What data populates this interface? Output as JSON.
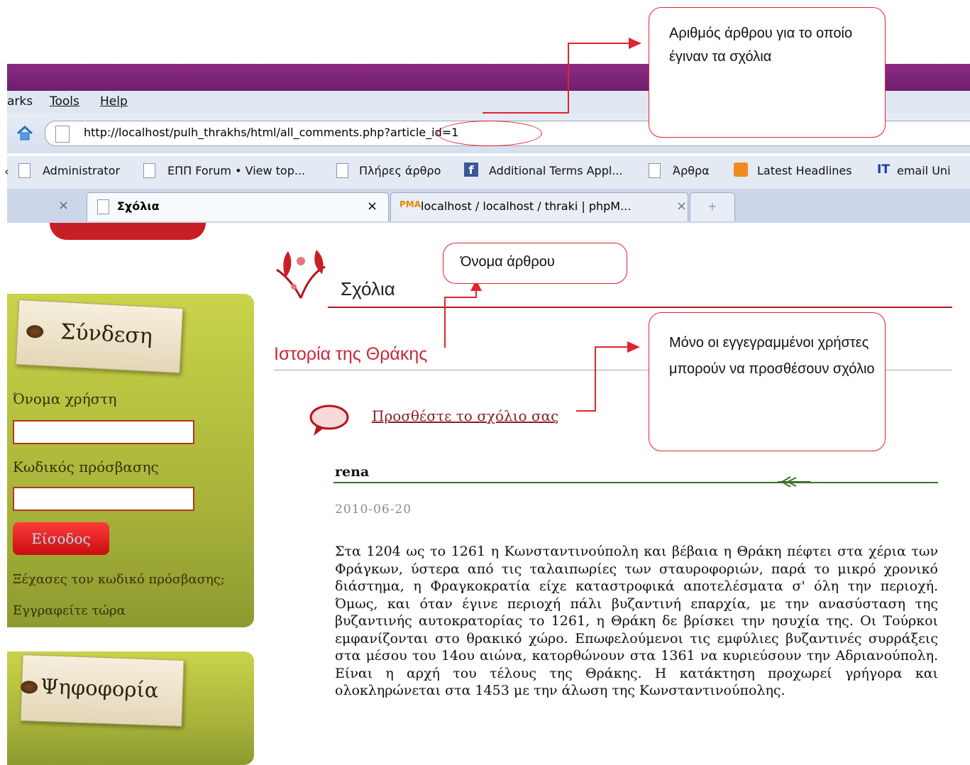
{
  "browser": {
    "menu": [
      "arks",
      "Tools",
      "Help"
    ],
    "url": "http://localhost/pulh_thrakhs/html/all_comments.php?article_id=1",
    "bookmarks": [
      "Administrator",
      "ΕΠΠ Forum • View top...",
      "Πλήρες άρθρο",
      "Additional Terms Appl...",
      "Άρθρα",
      "Latest Headlines",
      "email Uni"
    ],
    "tabs": [
      {
        "title": "Σχόλια",
        "close": "×"
      },
      {
        "title": "localhost / localhost / thraki | phpM...",
        "close": "×"
      },
      {
        "title": "+"
      }
    ],
    "tab_prev_close": "×"
  },
  "sidebar": {
    "login_title": "Σύνδεση",
    "username_label": "Όνομα χρήστη",
    "username_value": "",
    "password_label": "Κωδικός πρόσβασης",
    "password_value": "",
    "login_button": "Είσοδος",
    "forgot_link": "Ξέχασες τον κωδικό πρόσβασης;",
    "register_link": "Εγγραφείτε τώρα",
    "poll_title": "Ψηφοφορία"
  },
  "main": {
    "section_title": "Σχόλια",
    "article_title": "Ιστορία της Θράκης",
    "add_comment_link": "Προσθέστε το σχόλιο σας",
    "comment": {
      "author": "rena",
      "date": "2010-06-20",
      "body": "Στα 1204 ως το 1261 η Κωνσταντινούπολη και βέβαια η Θράκη πέφτει στα χέρια των Φράγκων, ύστερα από τις ταλαιπωρίες των σταυροφοριών, παρά το μικρό χρονικό διάστημα, η Φραγκοκρατία είχε καταστροφικά αποτελέσματα σ' όλη την περιοχή. Όμως, και όταν έγινε περιοχή πάλι βυζαντινή επαρχία, με την ανασύσταση της βυζαντινής αυτοκρατορίας το 1261, η Θράκη δε βρίσκει την ησυχία της. Οι Τούρκοι εμφανίζονται στο θρακικό χώρο. Επωφελούμενοι τις εμφύλιες βυζαντινές συρράξεις στα μέσου του 14ου αιώνα, κατορθώνουν στα 1361 να κυριεύσουν την Αδριανούπολη. Είναι η αρχή του τέλους της Θράκης. Η κατάκτηση προχωρεί γρήγορα και ολοκληρώνεται στα 1453 με την άλωση της Κωνσταντινούπολης."
    }
  },
  "annotations": {
    "article_id": "Αριθμός άρθρου  για το οποίο έγιναν τα σχόλια",
    "article_name": "Όνομα άρθρου",
    "registered_only": "Μόνο οι εγγεγραμμένοι χρήστες μπορούν να προσθέσουν σχόλιο"
  },
  "colors": {
    "accent_red": "#e0242e",
    "title_red": "#c8283a",
    "titlebar_purple": "#7a2577",
    "sidebar_green": "#b7c23f"
  }
}
